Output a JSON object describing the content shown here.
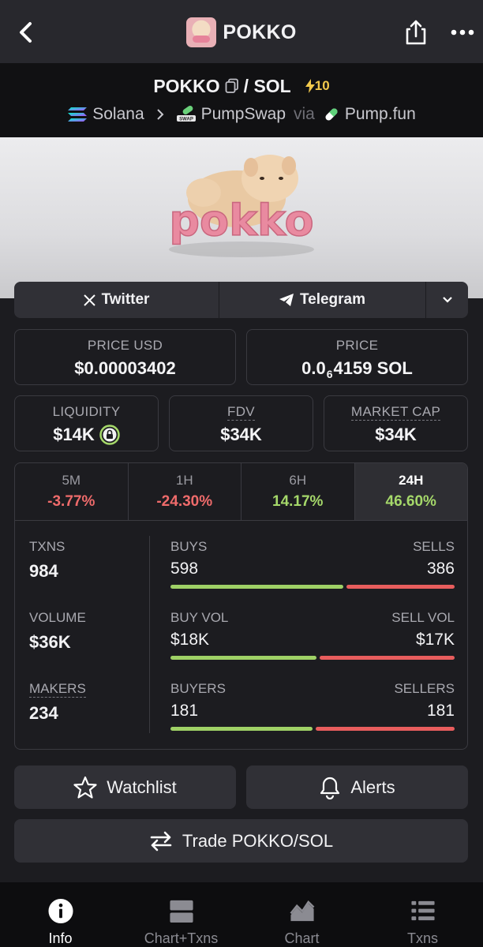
{
  "header": {
    "title": "POKKO",
    "back_icon": "chevron-left-icon",
    "share_icon": "share-icon",
    "more_icon": "more-horizontal-icon"
  },
  "pair": {
    "base": "POKKO",
    "separator": "/ SOL",
    "boost": "10",
    "chain": "Solana",
    "dex": "PumpSwap",
    "via": "via",
    "launchpad": "Pump.fun"
  },
  "banner": {
    "logo_text": "pokko"
  },
  "socials": {
    "twitter": "Twitter",
    "telegram": "Telegram"
  },
  "stats": {
    "price_usd_label": "PRICE USD",
    "price_usd_value": "$0.00003402",
    "price_label": "PRICE",
    "price_prefix": "0.0",
    "price_sub": "6",
    "price_suffix": "4159 SOL",
    "liquidity_label": "LIQUIDITY",
    "liquidity_value": "$14K",
    "fdv_label": "FDV",
    "fdv_value": "$34K",
    "mcap_label": "MARKET CAP",
    "mcap_value": "$34K"
  },
  "timeframes": [
    {
      "label": "5M",
      "value": "-3.77%",
      "trend": "neg"
    },
    {
      "label": "1H",
      "value": "-24.30%",
      "trend": "neg"
    },
    {
      "label": "6H",
      "value": "14.17%",
      "trend": "pos"
    },
    {
      "label": "24H",
      "value": "46.60%",
      "trend": "pos",
      "active": true
    }
  ],
  "txns": {
    "txns_label": "TXNS",
    "txns_value": "984",
    "volume_label": "VOLUME",
    "volume_value": "$36K",
    "makers_label": "MAKERS",
    "makers_value": "234",
    "buys_label": "BUYS",
    "buys_value": "598",
    "sells_label": "SELLS",
    "sells_value": "386",
    "buys_share": 0.608,
    "buyvol_label": "BUY VOL",
    "buyvol_value": "$18K",
    "sellvol_label": "SELL VOL",
    "sellvol_value": "$17K",
    "buyvol_share": 0.514,
    "buyers_label": "BUYERS",
    "buyers_value": "181",
    "sellers_label": "SELLERS",
    "sellers_value": "181",
    "buyers_share": 0.5
  },
  "actions": {
    "watchlist": "Watchlist",
    "alerts": "Alerts",
    "trade": "Trade POKKO/SOL"
  },
  "nav": {
    "info": "Info",
    "chart_txns": "Chart+Txns",
    "chart": "Chart",
    "txns": "Txns"
  },
  "colors": {
    "positive": "#a5d86a",
    "negative": "#ef6b6b",
    "boost": "#f2c94c"
  }
}
